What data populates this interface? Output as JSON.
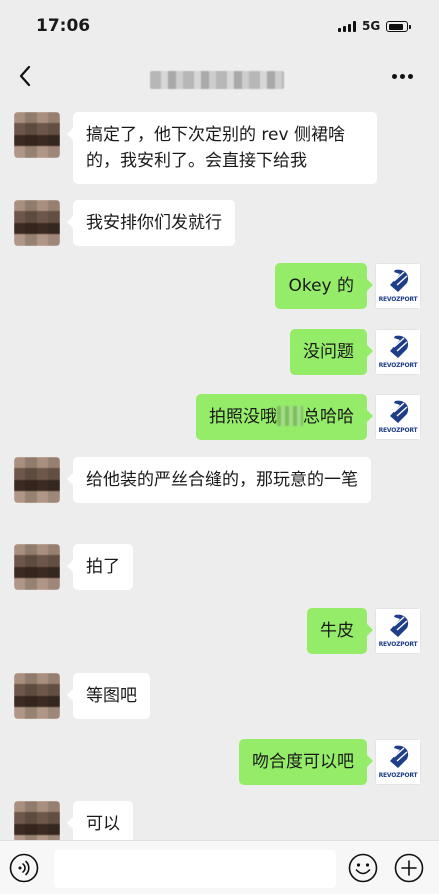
{
  "status_bar": {
    "time": "17:06",
    "network": "5G"
  },
  "nav": {
    "icons": [
      "back-arrow-icon",
      "more-dots-icon"
    ]
  },
  "brand": {
    "logo_text": "REVOZPORT",
    "logo_color": "#1f3e8a"
  },
  "colors": {
    "background": "#ededed",
    "bubble_self": "#95ec69",
    "bubble_other": "#ffffff"
  },
  "messages": [
    {
      "side": "left",
      "text": "搞定了，他下次定别的 rev 侧裙啥的，我安利了。会直接下给我"
    },
    {
      "side": "left",
      "text": "我安排你们发就行"
    },
    {
      "side": "right",
      "text": "Okey 的"
    },
    {
      "side": "right",
      "text": "没问题"
    },
    {
      "side": "right",
      "text_before": "拍照没哦",
      "text_after": "总哈哈"
    },
    {
      "side": "left",
      "text": "给他装的严丝合缝的，那玩意的一笔"
    },
    {
      "side": "left",
      "text": "拍了"
    },
    {
      "side": "right",
      "text": "牛皮"
    },
    {
      "side": "left",
      "text": "等图吧"
    },
    {
      "side": "right",
      "text": "吻合度可以吧"
    },
    {
      "side": "left",
      "text": "可以"
    }
  ],
  "input_bar": {
    "icons": [
      "voice-icon",
      "emoji-icon",
      "plus-icon"
    ],
    "value": ""
  }
}
